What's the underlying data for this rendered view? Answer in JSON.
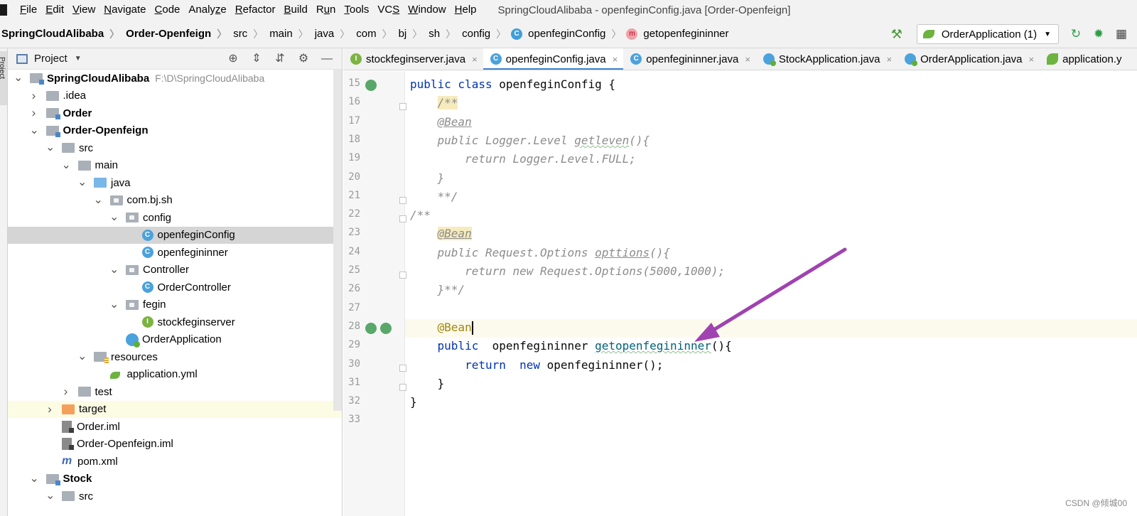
{
  "menubar": {
    "items": [
      {
        "label": "File",
        "u": "F"
      },
      {
        "label": "Edit",
        "u": "E"
      },
      {
        "label": "View",
        "u": "V"
      },
      {
        "label": "Navigate",
        "u": "N"
      },
      {
        "label": "Code",
        "u": "C"
      },
      {
        "label": "Analyze",
        "u": "z"
      },
      {
        "label": "Refactor",
        "u": "R"
      },
      {
        "label": "Build",
        "u": "B"
      },
      {
        "label": "Run",
        "u": "u"
      },
      {
        "label": "Tools",
        "u": "T"
      },
      {
        "label": "VCS",
        "u": "S"
      },
      {
        "label": "Window",
        "u": "W"
      },
      {
        "label": "Help",
        "u": "H"
      }
    ],
    "window_title": "SpringCloudAlibaba - openfeginConfig.java [Order-Openfeign]"
  },
  "breadcrumb": {
    "items": [
      "SpringCloudAlibaba",
      "Order-Openfeign",
      "src",
      "main",
      "java",
      "com",
      "bj",
      "sh",
      "config",
      "openfeginConfig",
      "getopenfegininner"
    ],
    "class_icon": "C",
    "method_icon": "m"
  },
  "toolbar": {
    "run_config": "OrderApplication (1)",
    "hammer_icon": "build-hammer-icon",
    "rerun_icon": "rerun-icon",
    "debug_icon": "debug-bug-icon",
    "coverage_icon": "coverage-icon"
  },
  "sidestrip": {
    "label": "Project"
  },
  "project": {
    "title": "Project",
    "tree": [
      {
        "label": "SpringCloudAlibaba",
        "sub": "F:\\D\\SpringCloudAlibaba",
        "level": 0,
        "arrow": "open",
        "icon": "module",
        "bold": true
      },
      {
        "label": ".idea",
        "level": 1,
        "arrow": "closed",
        "icon": "folder"
      },
      {
        "label": "Order",
        "level": 1,
        "arrow": "closed",
        "icon": "module",
        "bold": true
      },
      {
        "label": "Order-Openfeign",
        "level": 1,
        "arrow": "open",
        "icon": "module",
        "bold": true
      },
      {
        "label": "src",
        "level": 2,
        "arrow": "open",
        "icon": "folder"
      },
      {
        "label": "main",
        "level": 3,
        "arrow": "open",
        "icon": "folder"
      },
      {
        "label": "java",
        "level": 4,
        "arrow": "open",
        "icon": "blue"
      },
      {
        "label": "com.bj.sh",
        "level": 5,
        "arrow": "open",
        "icon": "pkg"
      },
      {
        "label": "config",
        "level": 6,
        "arrow": "open",
        "icon": "pkg"
      },
      {
        "label": "openfeginConfig",
        "level": 7,
        "arrow": "none",
        "icon": "class",
        "selected": true
      },
      {
        "label": "openfegininner",
        "level": 7,
        "arrow": "none",
        "icon": "class"
      },
      {
        "label": "Controller",
        "level": 6,
        "arrow": "open",
        "icon": "pkg"
      },
      {
        "label": "OrderController",
        "level": 7,
        "arrow": "none",
        "icon": "class"
      },
      {
        "label": "fegin",
        "level": 6,
        "arrow": "open",
        "icon": "pkg"
      },
      {
        "label": "stockfeginserver",
        "level": 7,
        "arrow": "none",
        "icon": "interface"
      },
      {
        "label": "OrderApplication",
        "level": 6,
        "arrow": "none",
        "icon": "app"
      },
      {
        "label": "resources",
        "level": 4,
        "arrow": "open",
        "icon": "res"
      },
      {
        "label": "application.yml",
        "level": 5,
        "arrow": "none",
        "icon": "yml"
      },
      {
        "label": "test",
        "level": 3,
        "arrow": "closed",
        "icon": "folder"
      },
      {
        "label": "target",
        "level": 2,
        "arrow": "closed",
        "icon": "orange",
        "excluded": true
      },
      {
        "label": "Order.iml",
        "level": 2,
        "arrow": "none",
        "icon": "iml"
      },
      {
        "label": "Order-Openfeign.iml",
        "level": 2,
        "arrow": "none",
        "icon": "iml"
      },
      {
        "label": "pom.xml",
        "level": 2,
        "arrow": "none",
        "icon": "pom"
      },
      {
        "label": "Stock",
        "level": 1,
        "arrow": "open",
        "icon": "module",
        "bold": true
      },
      {
        "label": "src",
        "level": 2,
        "arrow": "open",
        "icon": "folder"
      }
    ]
  },
  "tabs": [
    {
      "label": "stockfeginserver.java",
      "icon": "i",
      "glyph": "I"
    },
    {
      "label": "openfeginConfig.java",
      "icon": "c",
      "glyph": "C",
      "active": true
    },
    {
      "label": "openfegininner.java",
      "icon": "c",
      "glyph": "C"
    },
    {
      "label": "StockApplication.java",
      "icon": "app",
      "glyph": ""
    },
    {
      "label": "OrderApplication.java",
      "icon": "app",
      "glyph": ""
    },
    {
      "label": "application.y",
      "icon": "yml",
      "glyph": ""
    }
  ],
  "tab_close": "×",
  "editor": {
    "lines": [
      {
        "n": "15",
        "tokens": [
          [
            "kw",
            "public class "
          ],
          [
            "",
            "openfeginConfig {"
          ]
        ]
      },
      {
        "n": "16",
        "tokens": [
          [
            "",
            "    "
          ],
          [
            "cm jdoc-hl",
            "/**"
          ]
        ]
      },
      {
        "n": "17",
        "tokens": [
          [
            "",
            "    "
          ],
          [
            "cm an-u",
            "@Bean"
          ]
        ]
      },
      {
        "n": "18",
        "tokens": [
          [
            "",
            "    "
          ],
          [
            "cm",
            "public Logger.Level "
          ],
          [
            "cm cls-u",
            "getleven"
          ],
          [
            "cm",
            "(){"
          ]
        ]
      },
      {
        "n": "19",
        "tokens": [
          [
            "",
            "        "
          ],
          [
            "cm",
            "return Logger.Level.FULL;"
          ]
        ]
      },
      {
        "n": "20",
        "tokens": [
          [
            "",
            "    "
          ],
          [
            "cm",
            "}"
          ]
        ]
      },
      {
        "n": "21",
        "tokens": [
          [
            "",
            "    "
          ],
          [
            "cm",
            "**/"
          ]
        ]
      },
      {
        "n": "22",
        "tokens": [
          [
            "cm",
            "/**"
          ]
        ]
      },
      {
        "n": "23",
        "tokens": [
          [
            "",
            "    "
          ],
          [
            "cm an-u jdoc-hl",
            "@Bean"
          ]
        ]
      },
      {
        "n": "24",
        "tokens": [
          [
            "",
            "    "
          ],
          [
            "cm",
            "public Request.Options "
          ],
          [
            "cm an-u",
            "opttions"
          ],
          [
            "cm",
            "(){"
          ]
        ]
      },
      {
        "n": "25",
        "tokens": [
          [
            "",
            "        "
          ],
          [
            "cm",
            "return new Request.Options(5000,1000);"
          ]
        ]
      },
      {
        "n": "26",
        "tokens": [
          [
            "",
            "    "
          ],
          [
            "cm",
            "}**/"
          ]
        ]
      },
      {
        "n": "27",
        "tokens": [
          [
            "",
            ""
          ]
        ]
      },
      {
        "n": "28",
        "tokens": [
          [
            "",
            "    "
          ],
          [
            "an",
            "@Bean"
          ]
        ],
        "caret": true
      },
      {
        "n": "29",
        "tokens": [
          [
            "",
            "    "
          ],
          [
            "kw",
            "public  "
          ],
          [
            "",
            "openfegininner "
          ],
          [
            "m",
            "getopenfegininner"
          ],
          [
            "",
            "(){"
          ]
        ]
      },
      {
        "n": "30",
        "tokens": [
          [
            "",
            "        "
          ],
          [
            "kw",
            "return  new "
          ],
          [
            "",
            "openfegininner();"
          ]
        ]
      },
      {
        "n": "31",
        "tokens": [
          [
            "",
            "    "
          ],
          [
            "",
            "}"
          ]
        ]
      },
      {
        "n": "32",
        "tokens": [
          [
            "",
            "}"
          ]
        ]
      },
      {
        "n": "33",
        "tokens": [
          [
            "",
            ""
          ]
        ]
      }
    ]
  },
  "watermark": "CSDN @倾城00",
  "colors": {
    "accent": "#4083c9",
    "annotation_arrow": "#a042b0"
  }
}
